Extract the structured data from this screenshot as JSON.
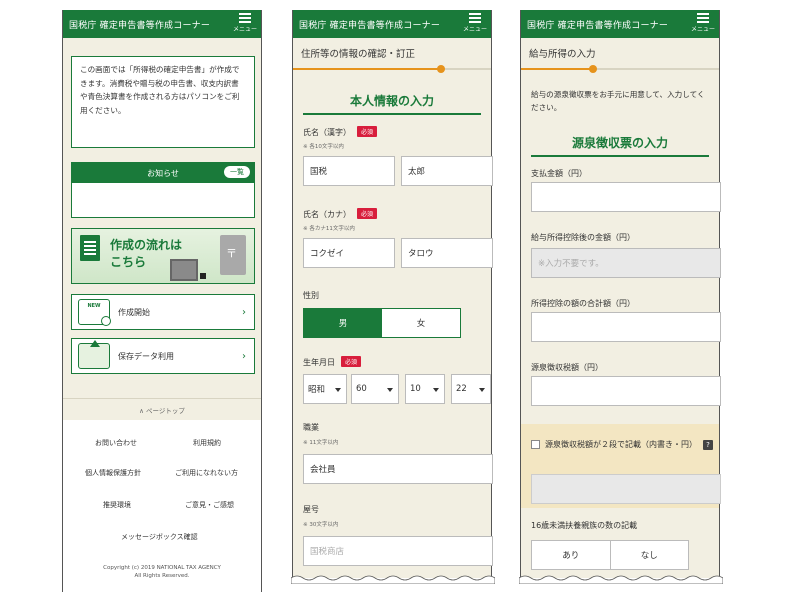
{
  "header": {
    "title": "国税庁 確定申告書等作成コーナー",
    "menu_label": "メニュー"
  },
  "panel1": {
    "intro": "この画面では「所得税の確定申告書」が作成できます。消費税や贈与税の申告書、収支内訳書や青色決算書を作成される方はパソコンをご利用ください。",
    "news_title": "お知らせ",
    "news_list_button": "一覧",
    "flow_banner": {
      "line1": "作成の流れは",
      "line2": "こちら"
    },
    "start_button": "作成開始",
    "saved_data_button": "保存データ利用",
    "page_top": "ページトップ",
    "footer_links": [
      "お問い合わせ",
      "利用規約",
      "個人情報保護方針",
      "ご利用になれない方",
      "推奨環境",
      "ご意見・ご感想",
      "メッセージボックス確認"
    ],
    "copyright_line1": "Copyright (c) 2019 NATIONAL TAX AGENCY",
    "copyright_line2": "All Rights Reserved."
  },
  "panel2": {
    "step_title": "住所等の情報の確認・訂正",
    "section_title": "本人情報の入力",
    "required": "必須",
    "name_kanji_label": "氏名（漢字）",
    "name_kanji_note": "※ 各10文字以内",
    "last_name_kanji": "国税",
    "first_name_kanji": "太郎",
    "name_kana_label": "氏名（カナ）",
    "name_kana_note": "※ 各カナ11文字以内",
    "last_name_kana": "コクゼイ",
    "first_name_kana": "タロウ",
    "gender_label": "性別",
    "gender_male": "男",
    "gender_female": "女",
    "birth_label": "生年月日",
    "era": "昭和",
    "year": "60",
    "month": "10",
    "day": "22",
    "occupation_label": "職業",
    "occupation_note": "※ 11文字以内",
    "occupation": "会社員",
    "trade_name_label": "屋号",
    "trade_name_note": "※ 30文字以内",
    "trade_name_placeholder": "国税商店"
  },
  "panel3": {
    "step_title": "給与所得の入力",
    "description": "給与の源泉徴収票をお手元に用意して、入力してください。",
    "section_title": "源泉徴収票の入力",
    "payment_label": "支払金額（円）",
    "after_deduction_label": "給与所得控除後の金額（円）",
    "after_deduction_placeholder": "※入力不要です。",
    "total_deduction_label": "所得控除の額の合計額（円）",
    "withholding_label": "源泉徴収税額（円）",
    "two_rows_label": "源泉徴収税額が２段で記載（内書き・円）",
    "help_mark": "?",
    "dependents_label": "16歳未満扶養親族の数の記載",
    "yes": "あり",
    "no": "なし"
  },
  "colors": {
    "brand_green": "#1a7a3a",
    "progress_orange": "#e6931c",
    "required_red": "#d81e3c",
    "background": "#f2efe2"
  }
}
